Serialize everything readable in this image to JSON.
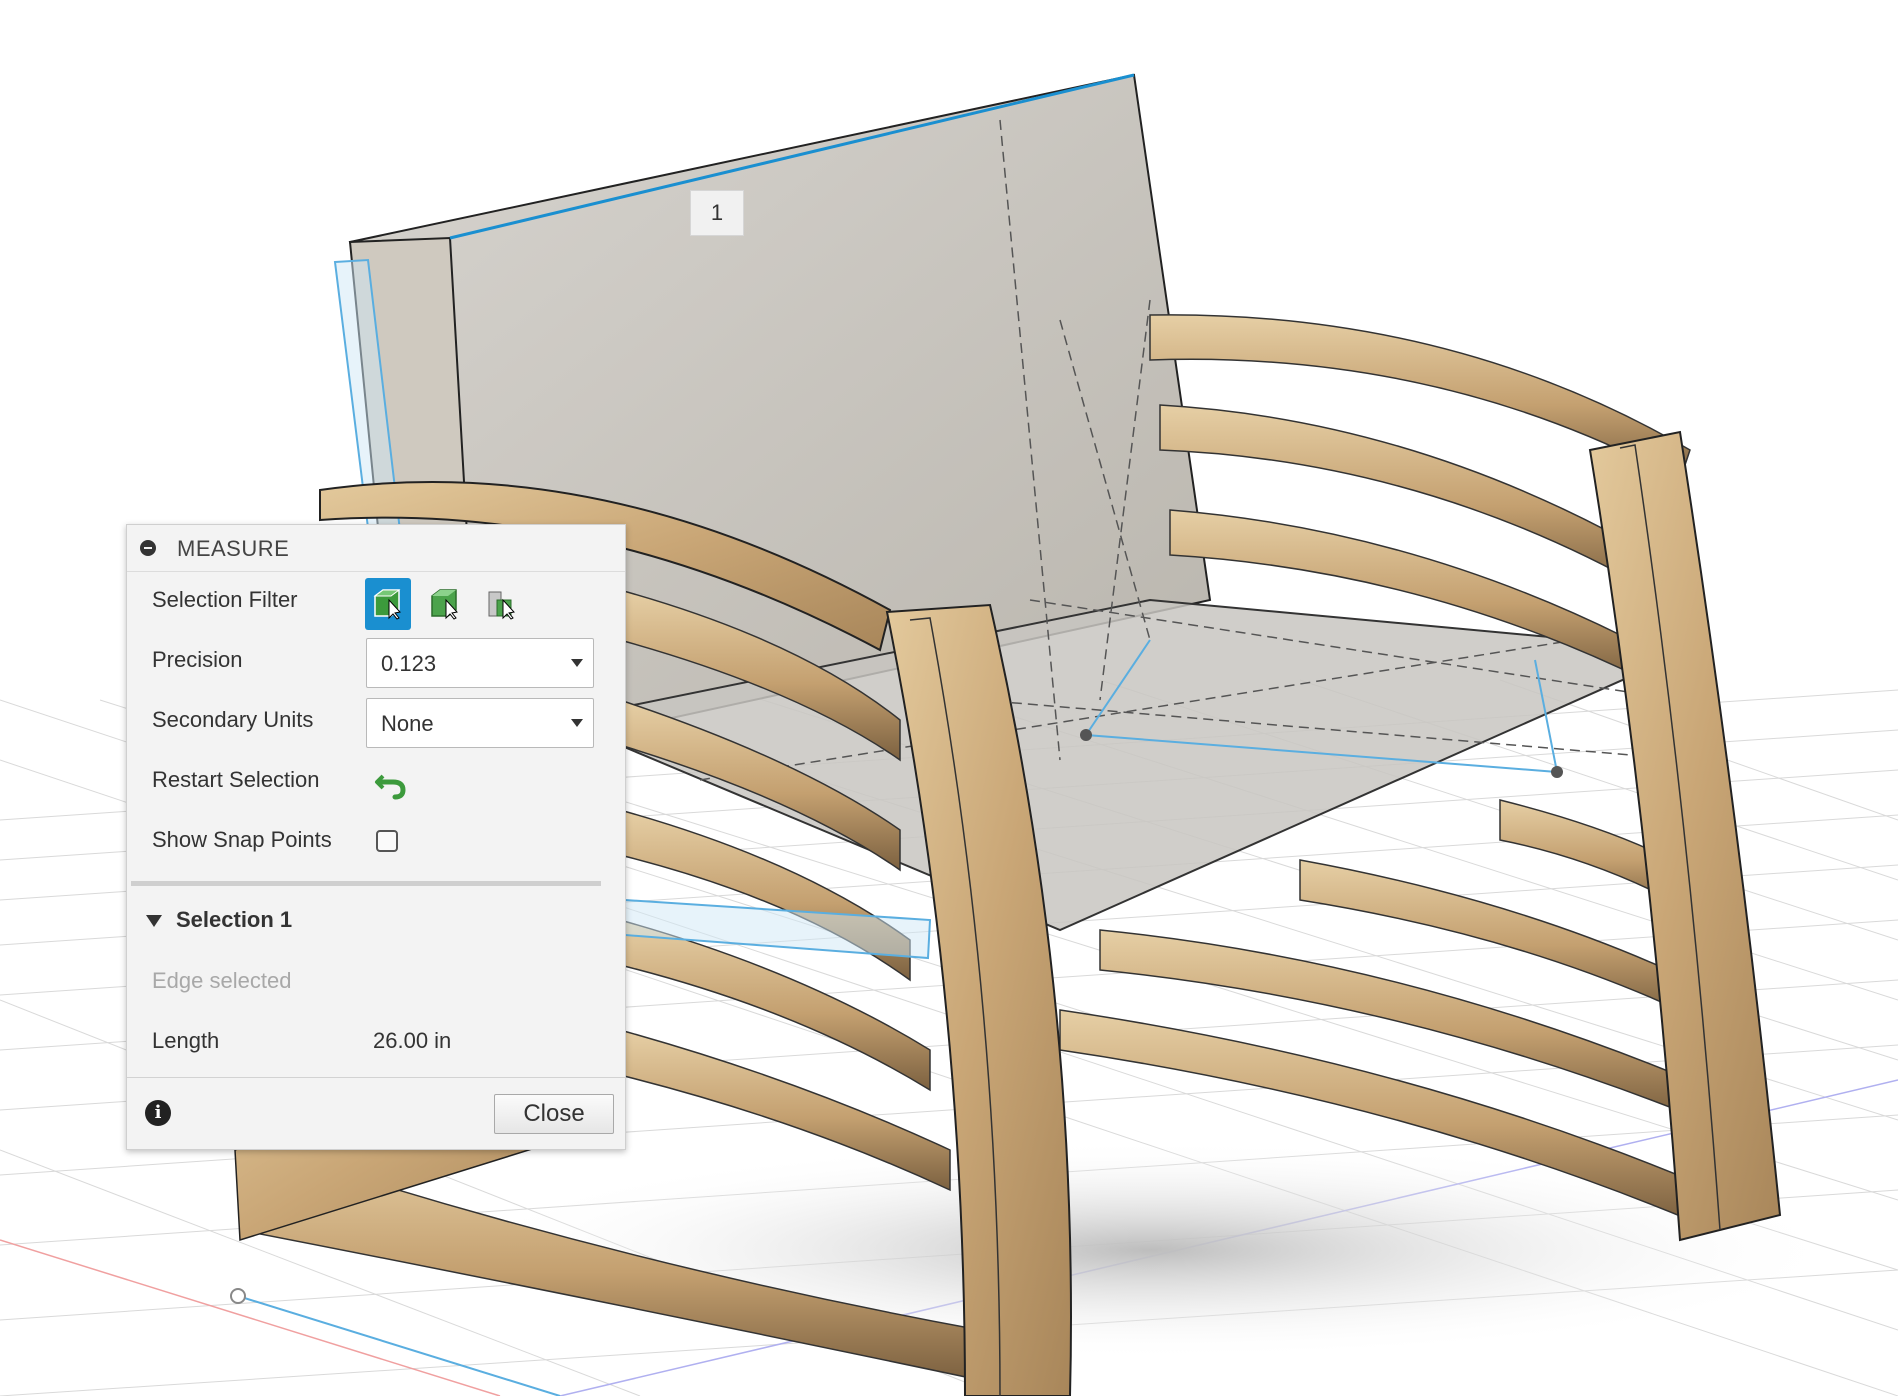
{
  "viewport": {
    "selection_label": "1"
  },
  "measure_panel": {
    "title": "MEASURE",
    "selection_filter_label": "Selection Filter",
    "selection_filter_options": [
      "select-bodies-icon",
      "select-faces-icon",
      "select-edges-icon"
    ],
    "precision_label": "Precision",
    "precision_value": "0.123",
    "secondary_units_label": "Secondary Units",
    "secondary_units_value": "None",
    "restart_selection_label": "Restart Selection",
    "show_snap_points_label": "Show Snap Points",
    "show_snap_points_checked": false,
    "selection_title": "Selection 1",
    "selection_status": "Edge selected",
    "length_label": "Length",
    "length_value": "26.00 in",
    "close_label": "Close"
  },
  "colors": {
    "accent": "#1a8fd0",
    "selection_highlight": "#5aaee0",
    "wood": "#c9a878",
    "grid": "#d8d8d8"
  }
}
